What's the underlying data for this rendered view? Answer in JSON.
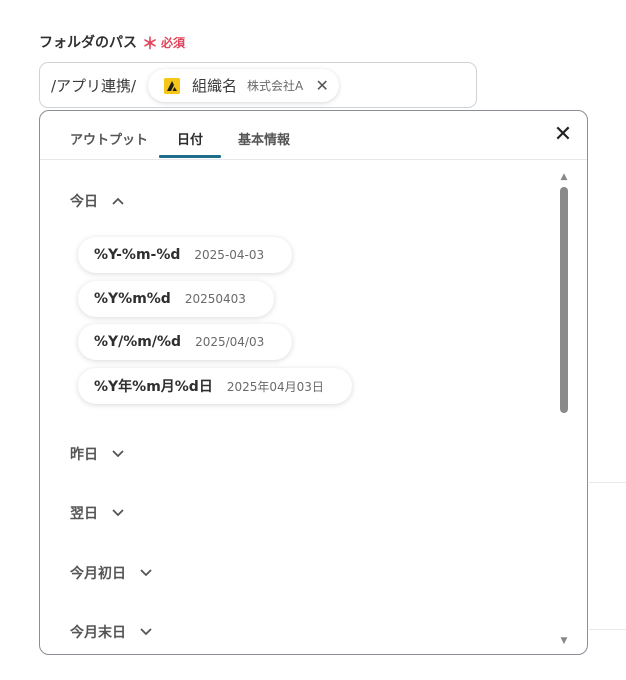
{
  "field": {
    "label": "フォルダのパス",
    "required_mark": "＊",
    "required_text": "必須"
  },
  "path_input": {
    "prefix": "/アプリ連携/",
    "chip": {
      "icon": "app-logo-icon",
      "name": "組織名",
      "value": "株式会社A",
      "close": "✕"
    }
  },
  "popover": {
    "tabs": [
      {
        "label": "アウトプット"
      },
      {
        "label": "日付"
      },
      {
        "label": "基本情報"
      }
    ],
    "active_tab": "日付",
    "close": "✕",
    "sections": [
      {
        "label": "今日",
        "expanded": true,
        "formats": [
          {
            "code": "%Y-%m-%d",
            "example": "2025-04-03"
          },
          {
            "code": "%Y%m%d",
            "example": "20250403"
          },
          {
            "code": "%Y/%m/%d",
            "example": "2025/04/03"
          },
          {
            "code": "%Y年%m月%d日",
            "example": "2025年04月03日"
          }
        ]
      },
      {
        "label": "昨日",
        "expanded": false
      },
      {
        "label": "翌日",
        "expanded": false
      },
      {
        "label": "今月初日",
        "expanded": false
      },
      {
        "label": "今月末日",
        "expanded": false
      }
    ]
  },
  "colors": {
    "required": "#e2445c",
    "accent": "#1f6f8b",
    "chip_icon": "#f5c518"
  }
}
